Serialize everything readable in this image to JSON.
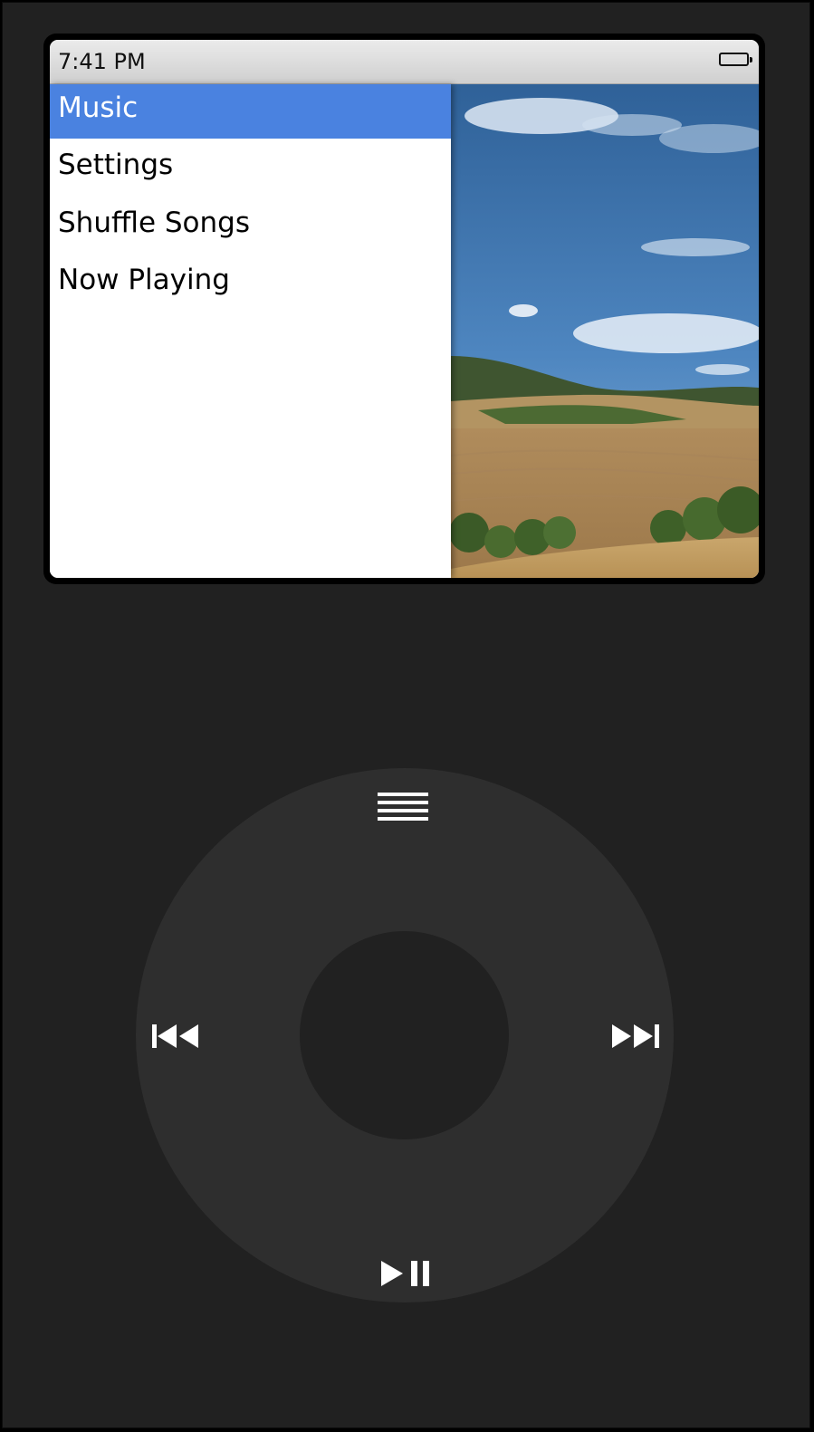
{
  "status_bar": {
    "time": "7:41 PM",
    "battery_icon": "battery-icon"
  },
  "menu": {
    "items": [
      {
        "label": "Music",
        "selected": true
      },
      {
        "label": "Settings",
        "selected": false
      },
      {
        "label": "Shuffle Songs",
        "selected": false
      },
      {
        "label": "Now Playing",
        "selected": false
      }
    ]
  },
  "wheel": {
    "menu_icon": "menu-icon",
    "previous_icon": "previous-track-icon",
    "next_icon": "next-track-icon",
    "play_pause_icon": "play-pause-icon"
  },
  "colors": {
    "body": "#212121",
    "wheel": "#2e2e2e",
    "selection": "#4a82e0"
  }
}
